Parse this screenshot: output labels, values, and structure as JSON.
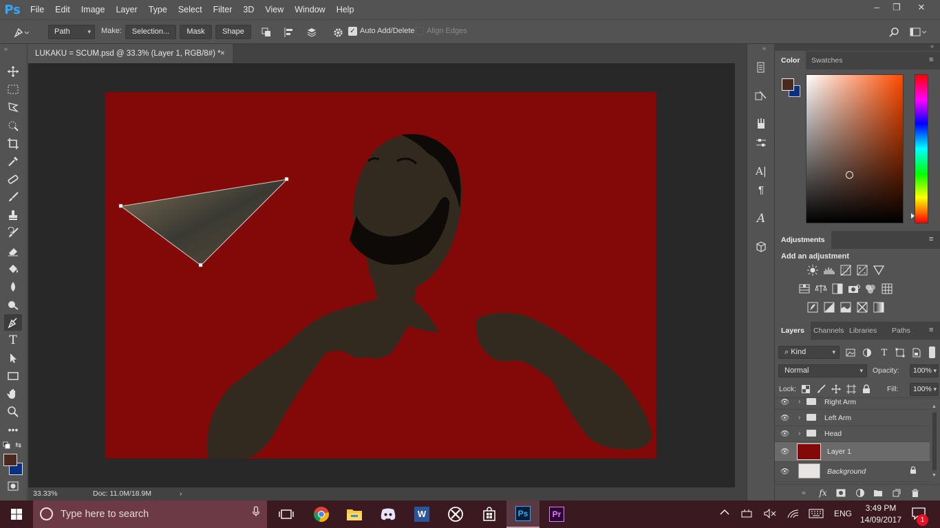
{
  "app": {
    "logo": "Ps"
  },
  "menu": [
    "File",
    "Edit",
    "Image",
    "Layer",
    "Type",
    "Select",
    "Filter",
    "3D",
    "View",
    "Window",
    "Help"
  ],
  "window_controls": [
    "–",
    "❐",
    "✕"
  ],
  "options": {
    "mode_value": "Path",
    "make_label": "Make:",
    "selection_label": "Selection...",
    "mask_label": "Mask",
    "shape_label": "Shape",
    "auto_add_delete_label": "Auto Add/Delete",
    "auto_add_delete_checked": true,
    "align_edges_label": "Align Edges",
    "align_edges_checked": false
  },
  "document": {
    "tab_title": "LUKAKU = SCUM.psd @ 33.3% (Layer 1, RGB/8#) *",
    "close_glyph": "×",
    "zoom": "33.33%",
    "doc_size": "Doc: 11.0M/18.9M",
    "canvas_color": "#830908",
    "figure_color": "#332a1f",
    "beard_color": "#0d0a08"
  },
  "color_panel": {
    "tabs": [
      "Color",
      "Swatches"
    ],
    "foreground": "#4a2a20",
    "background": "#0a3080",
    "hue_base": "#ff4a00"
  },
  "adjustments_panel": {
    "title": "Adjustments",
    "subtitle": "Add an adjustment"
  },
  "layers_panel": {
    "tabs": [
      "Layers",
      "Channels",
      "Libraries",
      "Paths"
    ],
    "filter_kind": "Kind",
    "blend_mode": "Normal",
    "opacity_label": "Opacity:",
    "opacity_value": "100%",
    "lock_label": "Lock:",
    "fill_label": "Fill:",
    "fill_value": "100%",
    "layers": [
      {
        "name": "Right Arm",
        "type": "group"
      },
      {
        "name": "Left Arm",
        "type": "group"
      },
      {
        "name": "Head",
        "type": "group"
      },
      {
        "name": "Layer 1",
        "type": "pixel",
        "selected": true,
        "thumb": "#830908"
      },
      {
        "name": "Background",
        "type": "pixel",
        "locked": true,
        "thumb": "#e8e4e4"
      }
    ],
    "footer_fx": "fx"
  },
  "taskbar": {
    "search_placeholder": "Type here to search",
    "language": "ENG",
    "time": "3:49 PM",
    "date": "14/09/2017",
    "notification_count": "1",
    "apps": [
      "task-view",
      "chrome",
      "file-explorer",
      "discord",
      "word",
      "xbox",
      "store",
      "photoshop",
      "premiere"
    ],
    "ps_label": "Ps",
    "pr_label": "Pr",
    "word_label": "W"
  }
}
